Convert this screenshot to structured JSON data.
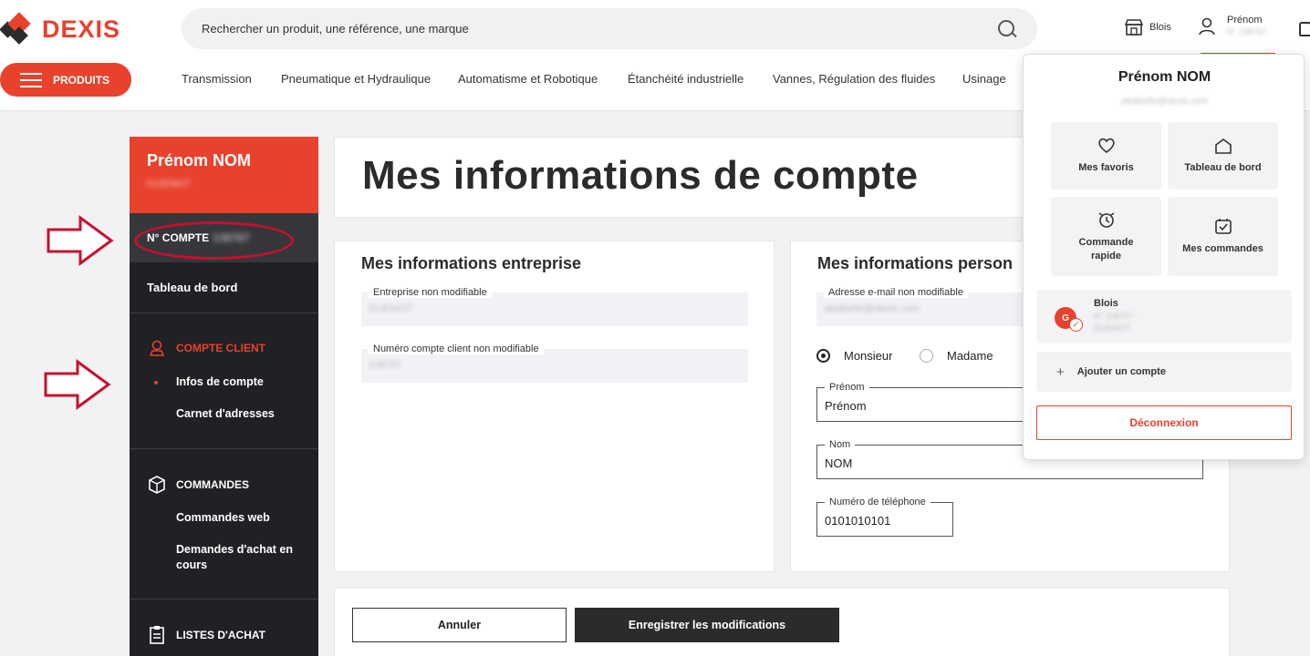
{
  "brand": {
    "name": "DEXIS",
    "accent": "#e8412c"
  },
  "search": {
    "placeholder": "Rechercher un produit, une référence, une marque"
  },
  "header": {
    "store_label": "Blois",
    "user_first": "Prénom",
    "user_sub": "N° 138767",
    "products_button": "PRODUITS",
    "categories": [
      "Transmission",
      "Pneumatique et Hydraulique",
      "Automatisme et Robotique",
      "Étanchéité industrielle",
      "Vannes, Régulation des fluides",
      "Usinage"
    ]
  },
  "sidebar": {
    "user_name": "Prénom NOM",
    "user_code": "DUENKIT",
    "account_prefix": "N° COMPTE",
    "account_number": "138767",
    "dashboard": "Tableau de bord",
    "compte_client": "COMPTE CLIENT",
    "infos_compte": "Infos de compte",
    "carnet_adresses": "Carnet d'adresses",
    "commandes": "COMMANDES",
    "commandes_web": "Commandes web",
    "demandes_achat": "Demandes d'achat en cours",
    "listes_achat": "LISTES D'ACHAT"
  },
  "main": {
    "title": "Mes informations de compte",
    "entreprise": {
      "heading": "Mes informations entreprise",
      "company_label": "Entreprise non modifiable",
      "company_value": "DUENKIT",
      "client_num_label": "Numéro compte client non modifiable",
      "client_num_value": "138767"
    },
    "personnel": {
      "heading": "Mes informations person",
      "email_label": "Adresse e-mail non modifiable",
      "email_value": "abalbelle@dexis.com",
      "monsieur": "Monsieur",
      "madame": "Madame",
      "prenom_label": "Prénom",
      "prenom_value": "Prénom",
      "nom_label": "Nom",
      "nom_value": "NOM",
      "phone_label": "Numéro de téléphone",
      "phone_value": "0101010101"
    },
    "cancel": "Annuler",
    "save": "Enregistrer les modifications"
  },
  "dropdown": {
    "name": "Prénom NOM",
    "email": "abalbelle@dexis.com",
    "favoris": "Mes favoris",
    "tableau": "Tableau de bord",
    "commande_rapide": "Commande rapide",
    "mes_commandes": "Mes commandes",
    "account_name": "Blois",
    "account_line1": "N° 138767",
    "account_line2": "DUENKIT",
    "avatar": "G",
    "add_account": "Ajouter un compte",
    "logout": "Déconnexion"
  }
}
